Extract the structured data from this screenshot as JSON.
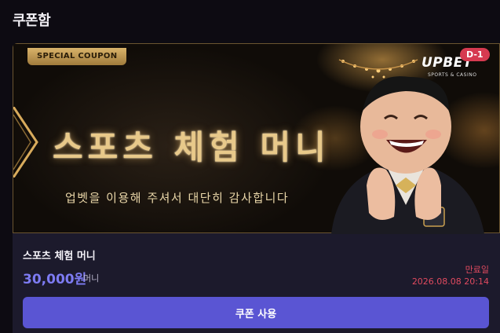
{
  "page": {
    "title": "쿠폰함"
  },
  "coupon": {
    "badge": "SPECIAL COUPON",
    "banner_headline": "스포츠 체험 머니",
    "banner_subline": "업벳을 이용해 주셔서 대단히 감사합니다",
    "brand_logo": "UPBET",
    "brand_logo_sub": "SPORTS & CASINO",
    "dday": "D-1",
    "name": "스포츠 체험 머니",
    "amount": "30,000원",
    "amount_unit": "머니",
    "expiry_label": "만료일",
    "expiry_date": "2026.08.08 20:14",
    "use_button_label": "쿠폰 사용"
  },
  "colors": {
    "accent": "#5a55d3",
    "amount": "#7d7bf2",
    "expiry": "#e04a5f",
    "gold": "#e8c98a"
  }
}
